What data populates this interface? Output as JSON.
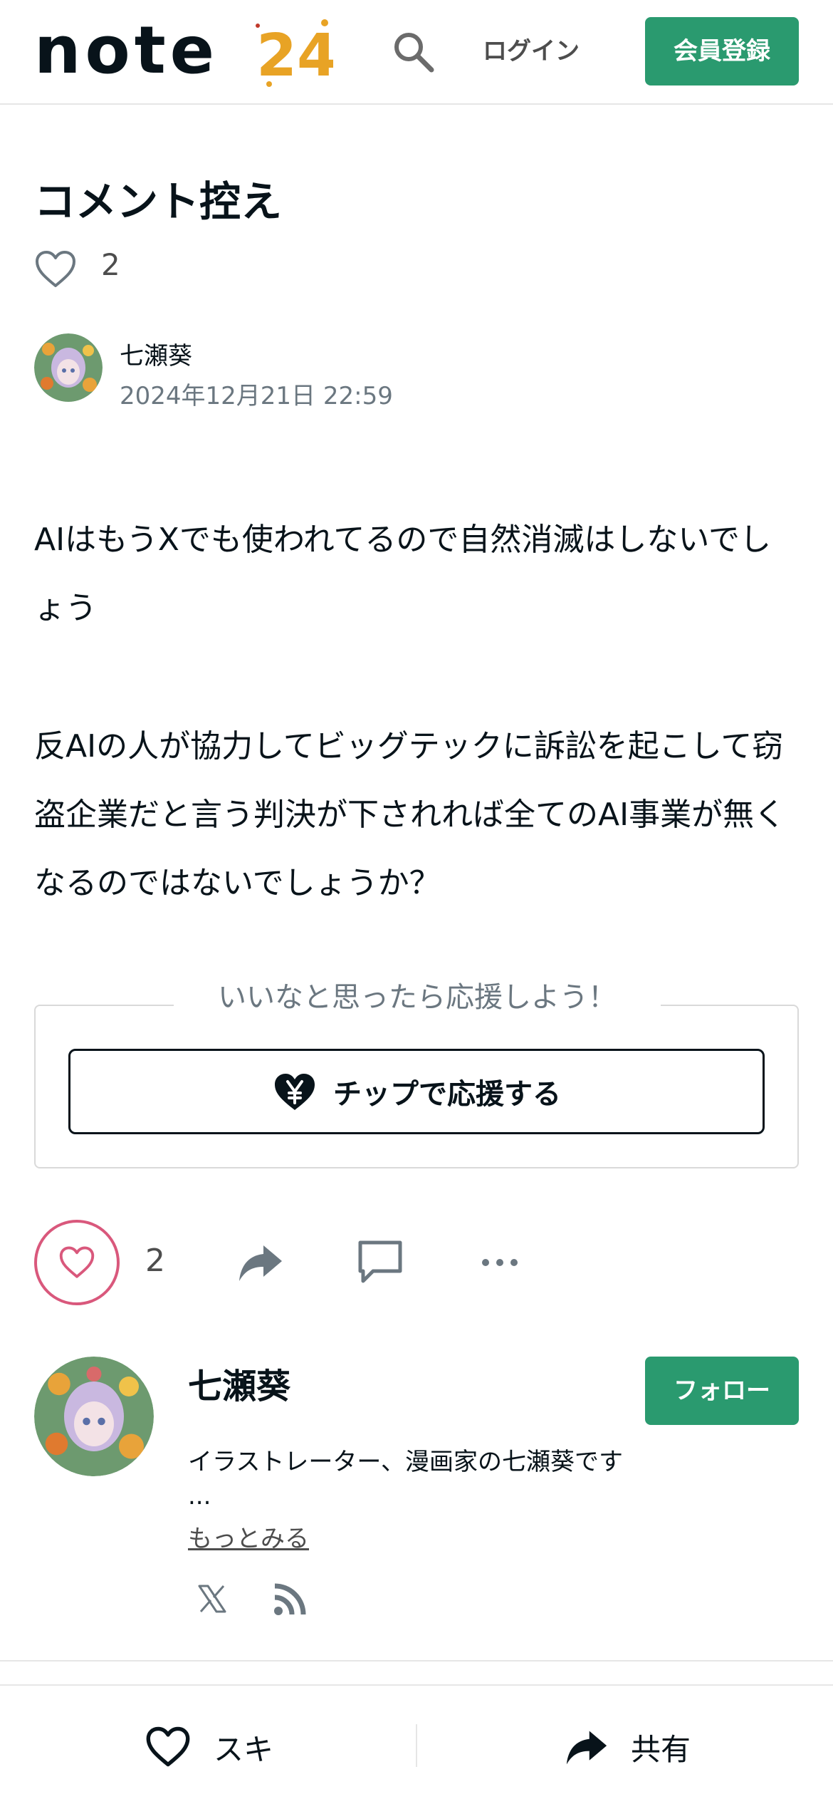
{
  "header": {
    "logo_text": "note",
    "logo_badge": "24",
    "login_label": "ログイン",
    "signup_label": "会員登録"
  },
  "article": {
    "title": "コメント控え",
    "like_count": "2",
    "author_name": "七瀬葵",
    "date": "2024年12月21日 22:59",
    "paragraphs": [
      "AIはもうXでも使われてるので自然消滅はしないでしょう",
      "反AIの人が協力してビッグテックに訴訟を起こして窃盗企業だと言う判決が下されれば全てのAI事業が無くなるのではないでしょうか？"
    ]
  },
  "support": {
    "label": "いいなと思ったら応援しよう！",
    "tip_button": "チップで応援する"
  },
  "actions": {
    "like_count": "2"
  },
  "author_card": {
    "name": "七瀬葵",
    "follow_label": "フォロー",
    "bio": "イラストレーター、漫画家の七瀬葵です",
    "ellipsis": "...",
    "more_link": "もっとみる"
  },
  "bottom_bar": {
    "like_label": "スキ",
    "share_label": "共有"
  },
  "icons": {
    "search": "search-icon",
    "heart": "heart-icon",
    "share": "share-icon",
    "comment": "comment-icon",
    "more": "more-icon",
    "x": "x-icon",
    "rss": "rss-icon",
    "tip": "yen-heart-icon"
  },
  "colors": {
    "brand_green": "#2a9a6f",
    "like_pink": "#d9587c",
    "text": "#08131a",
    "muted": "#6b7780"
  }
}
